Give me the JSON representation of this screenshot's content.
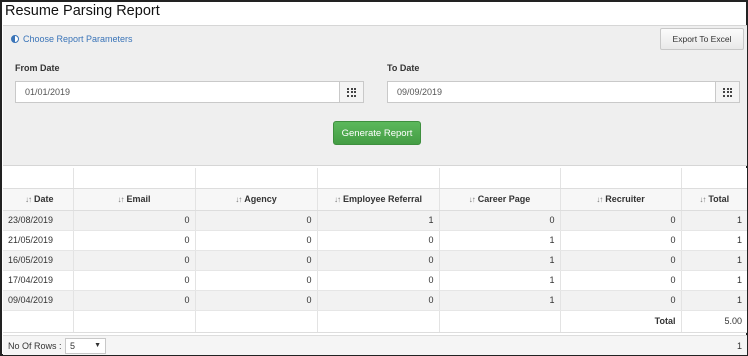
{
  "title": "Resume Parsing Report",
  "params": {
    "header": "Choose Report Parameters",
    "export_label": "Export To Excel",
    "from_label": "From Date",
    "from_value": "01/01/2019",
    "to_label": "To Date",
    "to_value": "09/09/2019",
    "generate_label": "Generate Report"
  },
  "table": {
    "columns": [
      "Date",
      "Email",
      "Agency",
      "Employee Referral",
      "Career Page",
      "Recruiter",
      "Total"
    ],
    "rows": [
      [
        "23/08/2019",
        "0",
        "0",
        "1",
        "0",
        "0",
        "1"
      ],
      [
        "21/05/2019",
        "0",
        "0",
        "0",
        "1",
        "0",
        "1"
      ],
      [
        "16/05/2019",
        "0",
        "0",
        "0",
        "1",
        "0",
        "1"
      ],
      [
        "17/04/2019",
        "0",
        "0",
        "0",
        "1",
        "0",
        "1"
      ],
      [
        "09/04/2019",
        "0",
        "0",
        "0",
        "1",
        "0",
        "1"
      ]
    ],
    "total_label": "Total",
    "total_value": "5.00"
  },
  "footer": {
    "rows_label": "No Of Rows :",
    "rows_value": "5",
    "page": "1"
  }
}
